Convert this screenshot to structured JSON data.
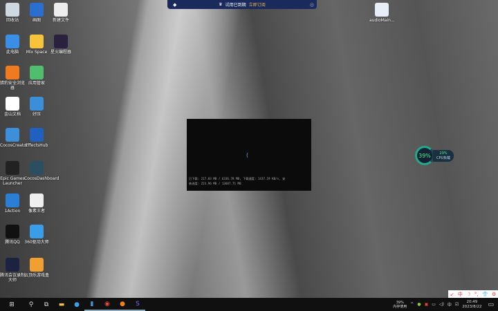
{
  "desktop_icons": [
    {
      "label": "回收站",
      "color": "#cfd8e0"
    },
    {
      "label": "此电脑",
      "color": "#3a8ee6"
    },
    {
      "label": "猎豹安全浏览器",
      "color": "#f07a20"
    },
    {
      "label": "金山文档",
      "color": "#ffffff"
    },
    {
      "label": "CocosCreator",
      "color": "#3d8fd9"
    },
    {
      "label": "Epic Games Launcher",
      "color": "#222222"
    },
    {
      "label": "1Action",
      "color": "#2a7fd4"
    },
    {
      "label": "腾讯QQ",
      "color": "#111111"
    },
    {
      "label": "腾讯会议录制大师",
      "color": "#1c2340"
    },
    {
      "label": "画图",
      "color": "#2a6fd0"
    },
    {
      "label": "Mix Space",
      "color": "#f5c43a"
    },
    {
      "label": "应用管家",
      "color": "#4fbf6e"
    },
    {
      "label": "好压",
      "color": "#3b8ed8"
    },
    {
      "label": "EffectsHub",
      "color": "#2060c0"
    },
    {
      "label": "CocosDashboard",
      "color": "#2a4f60"
    },
    {
      "label": "像素王者",
      "color": "#eeeeee"
    },
    {
      "label": "360驱动大师",
      "color": "#3a9de8"
    },
    {
      "label": "云顶乐游戏盒",
      "color": "#f0a030"
    },
    {
      "label": "新建文件",
      "color": "#eeeeee"
    },
    {
      "label": "星火编程器",
      "color": "#2a2040"
    },
    {
      "label": "audioMain...",
      "color": "#e8eef8"
    }
  ],
  "top_banner": {
    "text": "试用已到期",
    "link": "立即订阅"
  },
  "download_dialog": {
    "line1": "已下载: 217.03 MB / 6336.78 MB, 下载速度: 1437.19 KB/s, 安",
    "line2": "装进度: 223.96 MB / 13687.71 MB"
  },
  "cpu_widget": {
    "memory_percent": "39%",
    "cpu_percent": "29%",
    "cpu_label": "CPU负载"
  },
  "ime_toolbar": [
    "↙",
    "中",
    "☽",
    "°,",
    "👕",
    "⚙"
  ],
  "taskbar": {
    "memory_percent": "39%",
    "memory_label": "内存使用",
    "ime": "中",
    "time": "20:49",
    "date": "2023/8/22"
  }
}
